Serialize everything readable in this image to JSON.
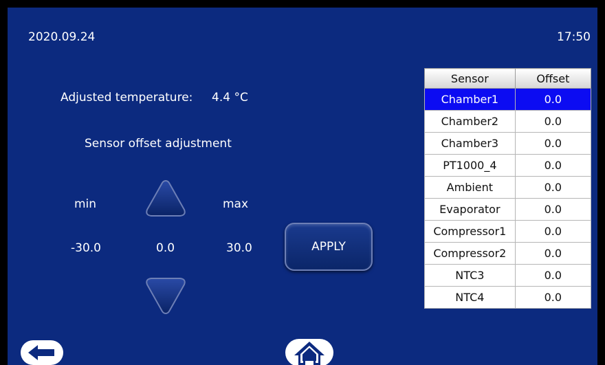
{
  "header": {
    "date": "2020.09.24",
    "time": "17:50"
  },
  "adjusted": {
    "label": "Adjusted temperature:",
    "value": "4.4 °C"
  },
  "section_title": "Sensor offset adjustment",
  "range": {
    "min_label": "min",
    "max_label": "max",
    "min_value": "-30.0",
    "current_value": "0.0",
    "max_value": "30.0"
  },
  "apply_label": "APPLY",
  "table": {
    "headers": [
      "Sensor",
      "Offset"
    ],
    "rows": [
      {
        "sensor": "Chamber1",
        "offset": "0.0"
      },
      {
        "sensor": "Chamber2",
        "offset": "0.0"
      },
      {
        "sensor": "Chamber3",
        "offset": "0.0"
      },
      {
        "sensor": "PT1000_4",
        "offset": "0.0"
      },
      {
        "sensor": "Ambient",
        "offset": "0.0"
      },
      {
        "sensor": "Evaporator",
        "offset": "0.0"
      },
      {
        "sensor": "Compressor1",
        "offset": "0.0"
      },
      {
        "sensor": "Compressor2",
        "offset": "0.0"
      },
      {
        "sensor": "NTC3",
        "offset": "0.0"
      },
      {
        "sensor": "NTC4",
        "offset": "0.0"
      }
    ],
    "selected_index": 0
  },
  "icons": {
    "increase": "up-arrow-icon",
    "decrease": "down-arrow-icon",
    "back": "back-arrow-icon",
    "home": "home-icon"
  },
  "colors": {
    "background": "#0c2a7f",
    "selected_row": "#0c0cf2",
    "text": "#ffffff"
  }
}
